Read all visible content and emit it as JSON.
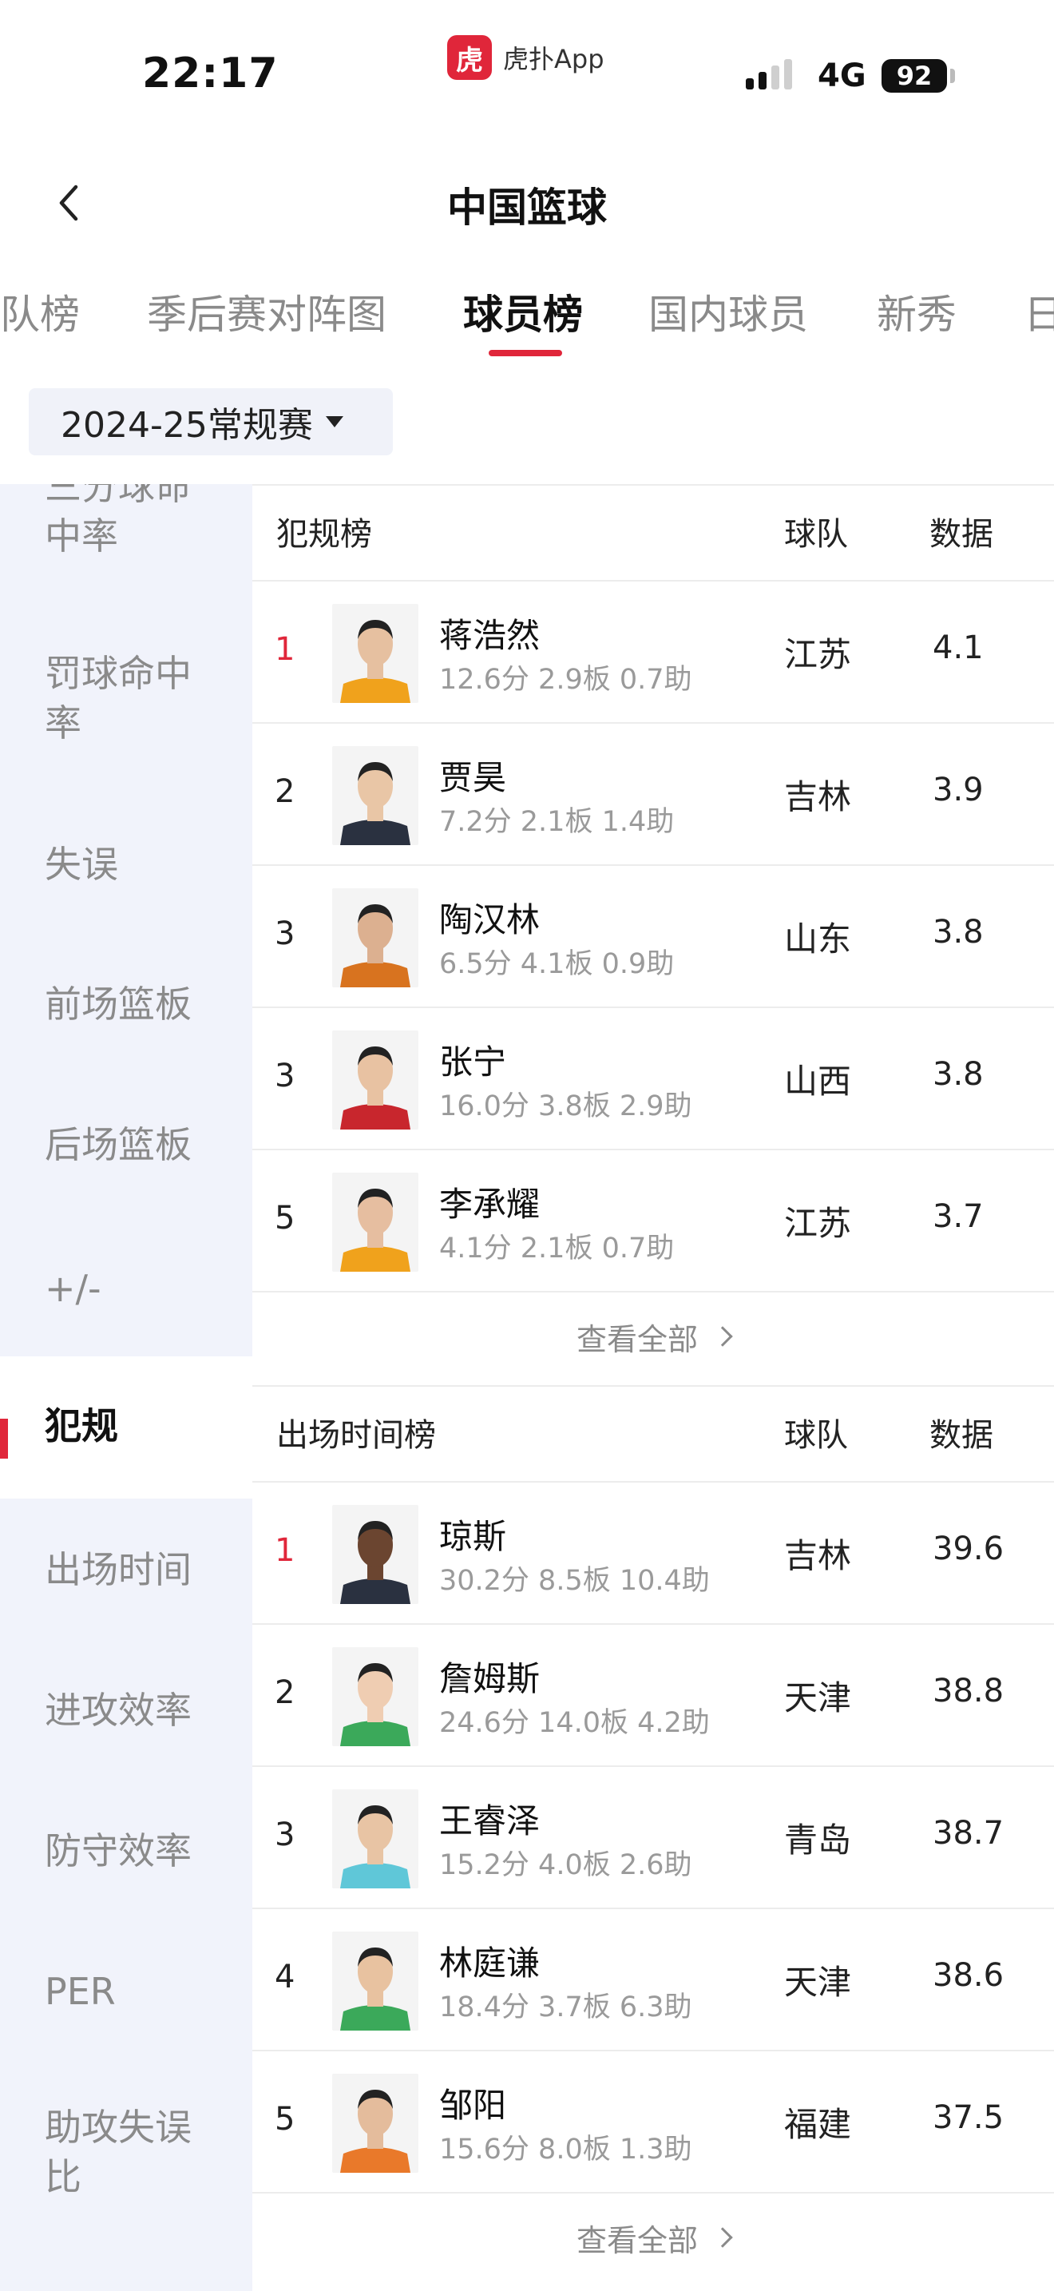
{
  "status_bar": {
    "time": "22:17",
    "app_logo_char": "虎",
    "app_name": "虎扑App",
    "network": "4G",
    "battery": "92"
  },
  "header": {
    "title": "中国篮球"
  },
  "tabs": [
    {
      "label": "队榜",
      "active": false
    },
    {
      "label": "季后赛对阵图",
      "active": false
    },
    {
      "label": "球员榜",
      "active": true
    },
    {
      "label": "国内球员",
      "active": false
    },
    {
      "label": "新秀",
      "active": false
    },
    {
      "label": "日",
      "active": false
    }
  ],
  "season_select": {
    "value": "2024-25常规赛"
  },
  "sidebar": {
    "items": [
      {
        "label": "三分球命中率",
        "active": false
      },
      {
        "label": "罚球命中率",
        "active": false
      },
      {
        "label": "失误",
        "active": false
      },
      {
        "label": "前场篮板",
        "active": false
      },
      {
        "label": "后场篮板",
        "active": false
      },
      {
        "label": "+/-",
        "active": false
      },
      {
        "label": "犯规",
        "active": true
      },
      {
        "label": "出场时间",
        "active": false
      },
      {
        "label": "进攻效率",
        "active": false
      },
      {
        "label": "防守效率",
        "active": false
      },
      {
        "label": "PER",
        "active": false
      },
      {
        "label": "助攻失误比",
        "active": false
      }
    ]
  },
  "colors": {
    "accent": "#e0263a",
    "sidebar_bg": "#f1f3fb",
    "muted_text": "#9a9a9a"
  },
  "sections": [
    {
      "title": "犯规榜",
      "col_team": "球队",
      "col_data": "数据",
      "view_all": "查看全部",
      "rows": [
        {
          "rank": "1",
          "name": "蒋浩然",
          "stats": "12.6分 2.9板 0.7助",
          "team": "江苏",
          "value": "4.1",
          "jersey": "#f0a21c",
          "skin": "#e6c0a0"
        },
        {
          "rank": "2",
          "name": "贾昊",
          "stats": "7.2分 2.1板 1.4助",
          "team": "吉林",
          "value": "3.9",
          "jersey": "#2a3140",
          "skin": "#e9c6a6"
        },
        {
          "rank": "3",
          "name": "陶汉林",
          "stats": "6.5分 4.1板 0.9助",
          "team": "山东",
          "value": "3.8",
          "jersey": "#d8731f",
          "skin": "#dcb090"
        },
        {
          "rank": "3",
          "name": "张宁",
          "stats": "16.0分 3.8板 2.9助",
          "team": "山西",
          "value": "3.8",
          "jersey": "#c8262d",
          "skin": "#e8c2a2"
        },
        {
          "rank": "5",
          "name": "李承耀",
          "stats": "4.1分 2.1板 0.7助",
          "team": "江苏",
          "value": "3.7",
          "jersey": "#f0a21c",
          "skin": "#e6bea0"
        }
      ]
    },
    {
      "title": "出场时间榜",
      "col_team": "球队",
      "col_data": "数据",
      "view_all": "查看全部",
      "rows": [
        {
          "rank": "1",
          "name": "琼斯",
          "stats": "30.2分 8.5板 10.4助",
          "team": "吉林",
          "value": "39.6",
          "jersey": "#2a3140",
          "skin": "#6b4530"
        },
        {
          "rank": "2",
          "name": "詹姆斯",
          "stats": "24.6分 14.0板 4.2助",
          "team": "天津",
          "value": "38.8",
          "jersey": "#3ba95a",
          "skin": "#efcdb2"
        },
        {
          "rank": "3",
          "name": "王睿泽",
          "stats": "15.2分 4.0板 2.6助",
          "team": "青岛",
          "value": "38.7",
          "jersey": "#5fc7d8",
          "skin": "#e8c4a4"
        },
        {
          "rank": "4",
          "name": "林庭谦",
          "stats": "18.4分 3.7板 6.3助",
          "team": "天津",
          "value": "38.6",
          "jersey": "#3ba95a",
          "skin": "#e8c2a0"
        },
        {
          "rank": "5",
          "name": "邹阳",
          "stats": "15.6分 8.0板 1.3助",
          "team": "福建",
          "value": "37.5",
          "jersey": "#e9792a",
          "skin": "#e4bc9c"
        }
      ]
    }
  ]
}
